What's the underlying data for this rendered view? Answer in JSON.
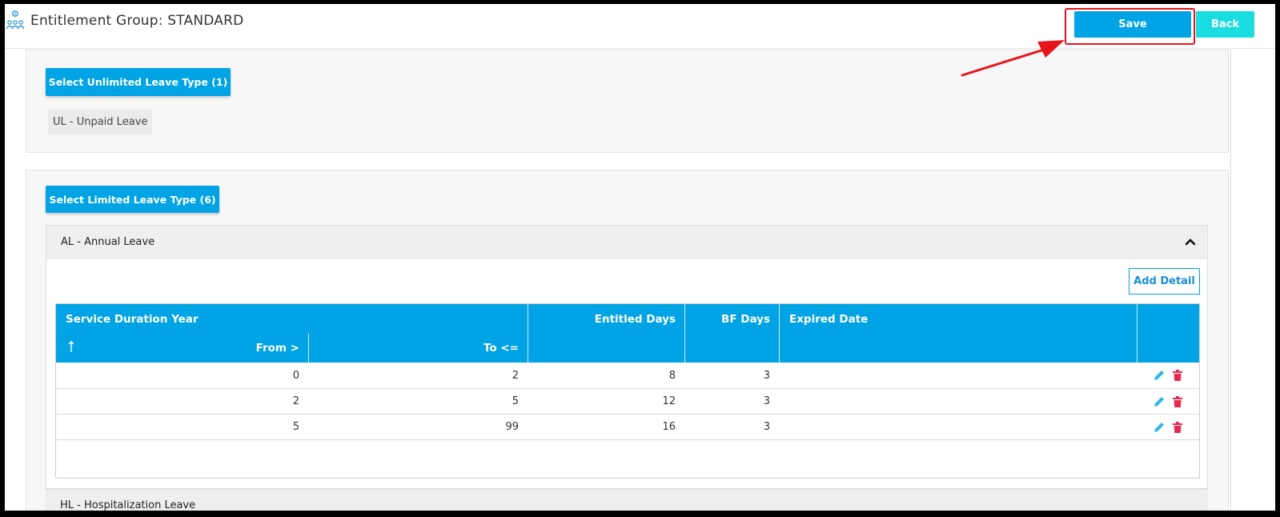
{
  "header": {
    "title": "Entitlement Group: STANDARD",
    "save_label": "Save",
    "back_label": "Back"
  },
  "unlimited": {
    "button_label": "Select Unlimited Leave Type (1)",
    "tag": "UL - Unpaid Leave"
  },
  "limited": {
    "button_label": "Select Limited Leave Type (6)",
    "accordion_title": "AL - Annual Leave",
    "add_detail_label": "Add Detail",
    "next_accordion_title": "HL - Hospitalization Leave",
    "table": {
      "group_header": "Service Duration Year",
      "sort_icon": "up-arrow-icon",
      "col_from": "From >",
      "col_to": "To <=",
      "col_entitled": "Entitled Days",
      "col_bf": "BF Days",
      "col_expired": "Expired Date",
      "rows": [
        {
          "from": "0",
          "to": "2",
          "entitled": "8",
          "bf": "3",
          "expired": ""
        },
        {
          "from": "2",
          "to": "5",
          "entitled": "12",
          "bf": "3",
          "expired": ""
        },
        {
          "from": "5",
          "to": "99",
          "entitled": "16",
          "bf": "3",
          "expired": ""
        }
      ]
    }
  },
  "colors": {
    "primary": "#00a3e4",
    "back": "#19dde0",
    "highlight": "#e8141d",
    "edit": "#2fb8e6",
    "delete": "#e8294d"
  }
}
